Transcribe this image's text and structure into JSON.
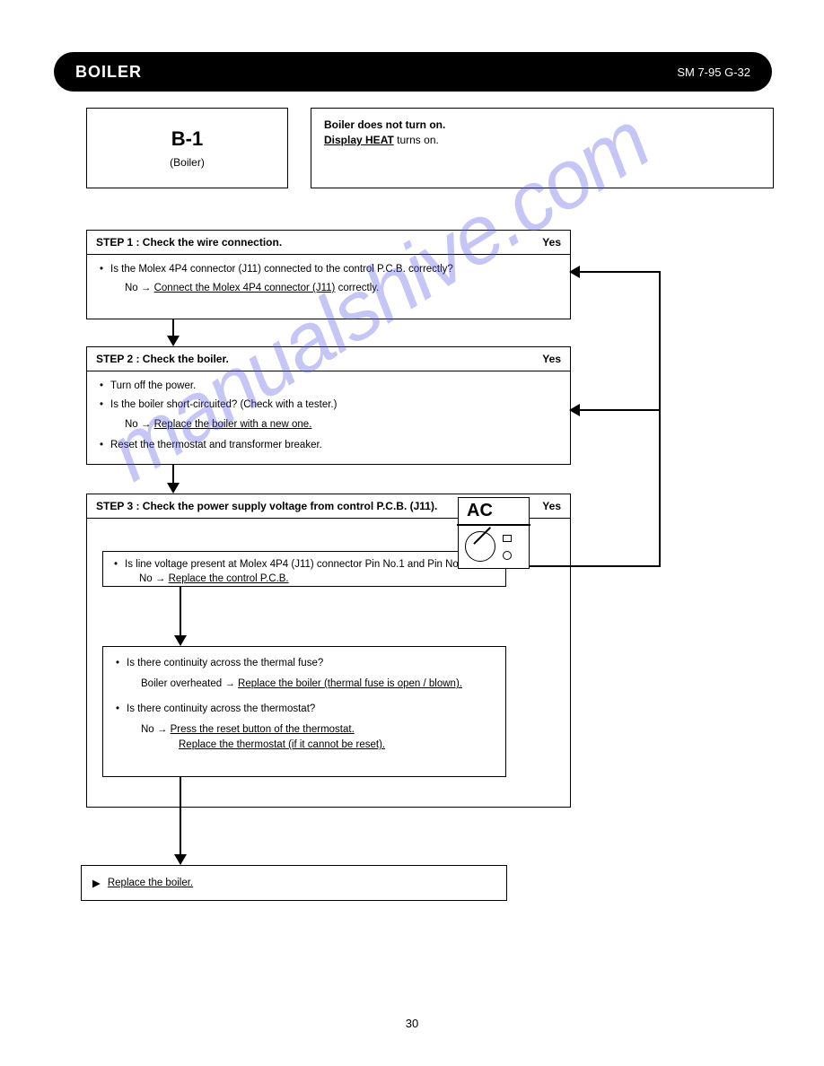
{
  "header": {
    "title": "BOILER",
    "pageref": "SM 7-95 G-32"
  },
  "code_box": {
    "code": "B-1",
    "sub": "(Boiler)"
  },
  "desc_box": {
    "line1": "Boiler does not turn on.",
    "line2_underline": "Display HEAT",
    "line2_rest": " turns on."
  },
  "step1": {
    "title": "STEP 1 : Check the wire connection.",
    "yes": "Yes",
    "bullet_q": "Is the Molex 4P4 connector (J11) connected to the control P.C.B. correctly?",
    "bullet_fix_u": "Connect the Molex 4P4 connector (J11)",
    "bullet_fix_rest": " correctly."
  },
  "step2": {
    "title": "STEP 2 : Check the boiler.",
    "yes": "Yes",
    "bullet1": "Turn off the power.",
    "bullet2q": "Is the boiler short-circuited? (Check with a tester.)",
    "bullet2fix_u": "Replace the boiler with a new one.",
    "bullet3": "Reset the thermostat and transformer breaker."
  },
  "step3": {
    "title": "STEP 3 : Check the power supply voltage from control P.C.B. (J11).",
    "yes": "Yes",
    "inner1_q": "Is line voltage present at Molex 4P4 (J11) connector Pin No.1 and Pin No.3?",
    "inner1_fix_u": "Replace the control P.C.B.",
    "inner2_b1q": "Is there continuity across the thermal fuse?",
    "inner2_b1fix_pre": "Boiler overheated → ",
    "inner2_b1fix_u": "Replace the boiler (thermal fuse is open / blown).",
    "inner2_b2q": "Is there continuity across the thermostat?",
    "inner2_b2fix_u1": "Press the reset button of the thermostat.",
    "inner2_b2fix_u2": "Replace the thermostat (if it cannot be reset)."
  },
  "svc": {
    "arrow": "▶",
    "text_u": "Replace the boiler."
  },
  "labels": {
    "no": "No"
  },
  "ac": {
    "label": "AC"
  },
  "footer": {
    "page": "30"
  },
  "watermark": "manualshive.com"
}
